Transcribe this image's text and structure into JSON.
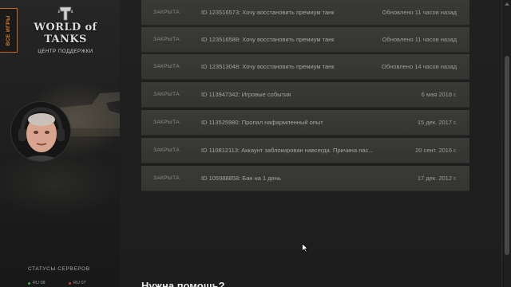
{
  "sidebar": {
    "games_tab_label": "ВСЕ ИГРЫ",
    "logo_text": "WORLD of TANKS",
    "logo_subtitle": "ЦЕНТР ПОДДЕРЖКИ",
    "servers_title": "СТАТУСЫ СЕРВЕРОВ",
    "servers": [
      {
        "name": "RU 08",
        "status_color": "#3fae49"
      },
      {
        "name": "RU 07",
        "status_color": "#c9402e"
      }
    ]
  },
  "tickets": [
    {
      "status": "ЗАКРЫТА",
      "title": "ID 123516573: Хочу восстановить премиум танк",
      "date": "Обновлено 11 часов назад"
    },
    {
      "status": "ЗАКРЫТА",
      "title": "ID 123516588: Хочу восстановить премиум танк",
      "date": "Обновлено 11 часов назад"
    },
    {
      "status": "ЗАКРЫТА",
      "title": "ID 123513048: Хочу восстановить премиум танк",
      "date": "Обновлено 14 часов назад"
    },
    {
      "status": "ЗАКРЫТА",
      "title": "ID 113947342: Игровые события",
      "date": "6 мая 2018 г."
    },
    {
      "status": "ЗАКРЫТА",
      "title": "ID 113525980: Пропал нафармленный опыт",
      "date": "15 дек. 2017 г."
    },
    {
      "status": "ЗАКРЫТА",
      "title": "ID 110812113: Аккаунт заблокирован навсегда. Причина пас...",
      "date": "20 сент. 2016 г."
    },
    {
      "status": "ЗАКРЫТА",
      "title": "ID 105988858: Бан на 1 день",
      "date": "17 дек. 2012 г."
    }
  ],
  "help_heading": "Нужна помощь?",
  "colors": {
    "accent": "#d97c2d",
    "ticket_bg": "#373734",
    "page_bg": "#1d1d1d"
  }
}
